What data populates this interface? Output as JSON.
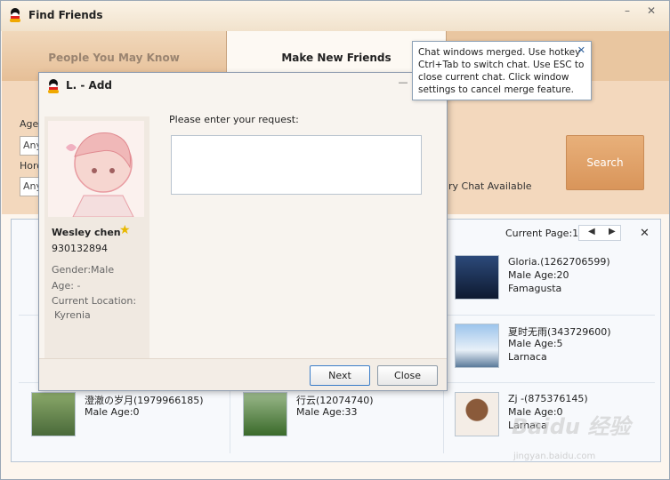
{
  "window": {
    "title": "Find Friends",
    "min": "–",
    "close": "✕"
  },
  "tabs": [
    {
      "label": "People You May Know"
    },
    {
      "label": "Make New Friends"
    }
  ],
  "filters": {
    "age_label": "Age:",
    "age_value": "Any",
    "horoscope_label": "Horo",
    "horoscope_value": "Any",
    "chat_available": "ry Chat Available",
    "search": "Search"
  },
  "results": {
    "page_label": "Current Page:1",
    "prev": "◀",
    "next": "▶",
    "close": "✕",
    "items": [
      {
        "name": "Gloria.(1262706599)",
        "sex_age": "Male Age:20",
        "location": "Famagusta",
        "avatar_color": "#1a2a4a"
      },
      {
        "name": "夏时无雨(343729600)",
        "sex_age": "Male Age:5",
        "location": "Larnaca",
        "avatar_color": "#7fa8d8"
      },
      {
        "name": "澄澈の岁月(1979966185)",
        "sex_age": "Male Age:0",
        "location": "",
        "avatar_color": "#6a8a4a"
      },
      {
        "name": "行云(12074740)",
        "sex_age": "Male Age:33",
        "location": "",
        "avatar_color": "#5a8a3a"
      },
      {
        "name": "Zj -(875376145)",
        "sex_age": "Male Age:0",
        "location": "Larnaca",
        "avatar_color": "#e8ddd4"
      }
    ]
  },
  "dialog": {
    "title": "L. - Add",
    "min": "—",
    "profile": {
      "name": "Wesley chen",
      "id": "930132894",
      "gender": "Gender:Male",
      "age": "Age: -",
      "location_label": "Current Location:",
      "location": "Kyrenia"
    },
    "request_label": "Please enter your request:",
    "request_value": "",
    "next": "Next",
    "close": "Close"
  },
  "tooltip": {
    "text": "Chat windows merged. Use hotkey Ctrl+Tab to switch chat. Use ESC to close current chat. Click window settings to cancel merge feature.",
    "close": "✕"
  },
  "watermark": {
    "text": "Baidu 经验",
    "url": "jingyan.baidu.com"
  }
}
